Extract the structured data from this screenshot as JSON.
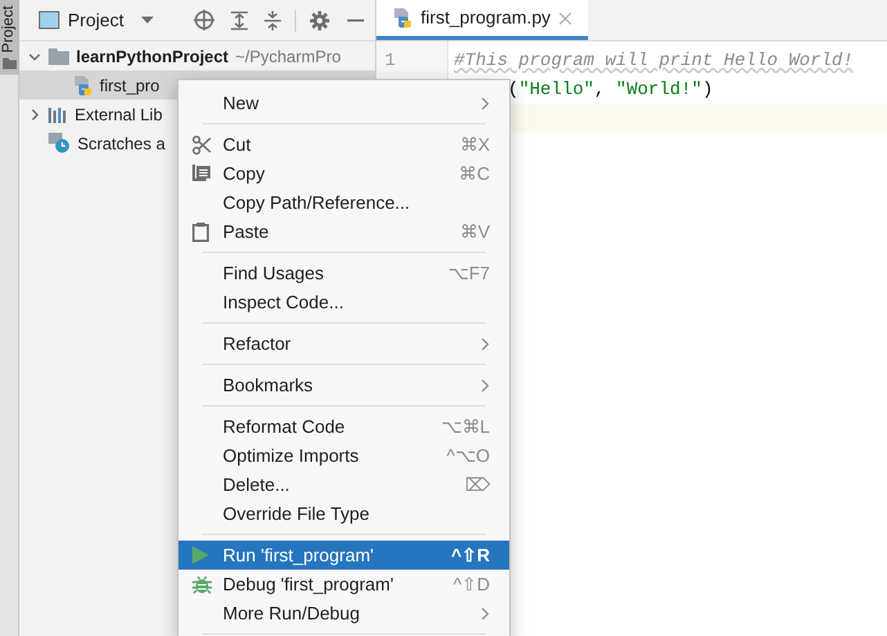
{
  "side_strip": {
    "label": "Project"
  },
  "project_panel": {
    "title": "Project",
    "tree": [
      {
        "kind": "folder",
        "label": "learnPythonProject",
        "path": "~/PycharmPro",
        "expanded": true,
        "selected": false,
        "children": [
          {
            "kind": "python",
            "label": "first_pro",
            "selected": true
          }
        ]
      },
      {
        "kind": "libraries",
        "label": "External Lib",
        "expanded": false,
        "selected": false
      },
      {
        "kind": "scratches",
        "label": "Scratches a",
        "selected": false
      }
    ]
  },
  "editor": {
    "tab": {
      "label": "first_program.py",
      "selected": true
    },
    "line_numbers": [
      "1"
    ],
    "lines": [
      {
        "segments": [
          {
            "kind": "comment",
            "text": "#This program will print Hello World!"
          }
        ]
      },
      {
        "segments": [
          {
            "kind": "punct",
            "text": "("
          },
          {
            "kind": "string",
            "text": "\"Hello\""
          },
          {
            "kind": "punct",
            "text": ", "
          },
          {
            "kind": "string",
            "text": "\"World!\""
          },
          {
            "kind": "punct",
            "text": ")"
          }
        ]
      },
      {
        "current": true
      }
    ]
  },
  "context_menu": [
    {
      "kind": "plain",
      "label": "New",
      "submenu": true,
      "selected": false
    },
    {
      "kind": "separator"
    },
    {
      "kind": "cut",
      "label": "Cut",
      "shortcut": "⌘X",
      "submenu": false,
      "selected": false
    },
    {
      "kind": "copy",
      "label": "Copy",
      "shortcut": "⌘C",
      "submenu": false,
      "selected": false
    },
    {
      "kind": "plain",
      "label": "Copy Path/Reference...",
      "submenu": false,
      "selected": false
    },
    {
      "kind": "paste",
      "label": "Paste",
      "shortcut": "⌘V",
      "submenu": false,
      "selected": false
    },
    {
      "kind": "separator"
    },
    {
      "kind": "plain",
      "label": "Find Usages",
      "shortcut": "⌥F7",
      "submenu": false,
      "selected": false
    },
    {
      "kind": "plain",
      "label": "Inspect Code...",
      "submenu": false,
      "selected": false
    },
    {
      "kind": "separator"
    },
    {
      "kind": "plain",
      "label": "Refactor",
      "submenu": true,
      "selected": false
    },
    {
      "kind": "separator"
    },
    {
      "kind": "plain",
      "label": "Bookmarks",
      "submenu": true,
      "selected": false
    },
    {
      "kind": "separator"
    },
    {
      "kind": "plain",
      "label": "Reformat Code",
      "shortcut": "⌥⌘L",
      "submenu": false,
      "selected": false
    },
    {
      "kind": "plain",
      "label": "Optimize Imports",
      "shortcut": "^⌥O",
      "submenu": false,
      "selected": false
    },
    {
      "kind": "plain",
      "label": "Delete...",
      "shortcut": "⌦",
      "submenu": false,
      "selected": false
    },
    {
      "kind": "plain",
      "label": "Override File Type",
      "submenu": false,
      "selected": false
    },
    {
      "kind": "separator"
    },
    {
      "kind": "run",
      "label": "Run 'first_program'",
      "shortcut": "^⇧R",
      "submenu": false,
      "selected": true
    },
    {
      "kind": "debug",
      "label": "Debug 'first_program'",
      "shortcut": "^⇧D",
      "submenu": false,
      "selected": false
    },
    {
      "kind": "plain",
      "label": "More Run/Debug",
      "submenu": true,
      "selected": false
    },
    {
      "kind": "separator"
    }
  ]
}
